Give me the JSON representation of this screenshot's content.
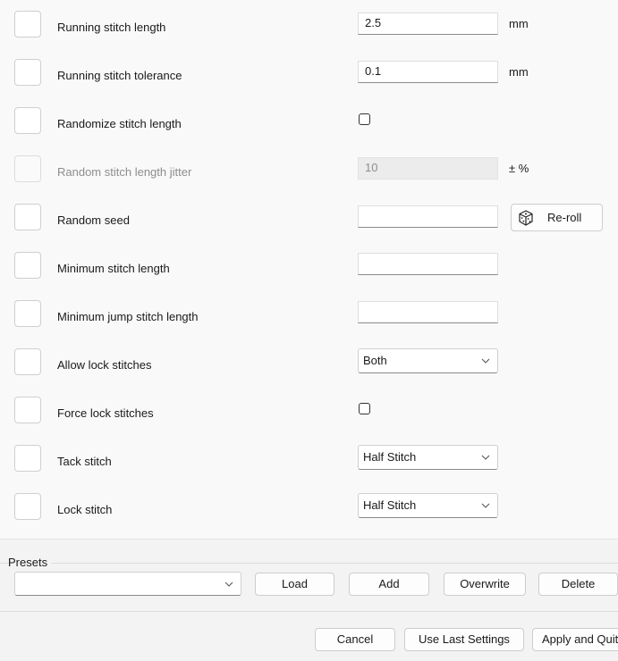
{
  "fields": [
    {
      "label": "Running stitch length",
      "value": "2.5",
      "unit": "mm"
    },
    {
      "label": "Running stitch tolerance",
      "value": "0.1",
      "unit": "mm"
    },
    {
      "label": "Randomize stitch length"
    },
    {
      "label": "Random stitch length jitter",
      "value": "10",
      "unit": "± %"
    },
    {
      "label": "Random seed",
      "value": "",
      "button": "Re-roll",
      "button_icon": "dice-icon"
    },
    {
      "label": "Minimum stitch length",
      "value": ""
    },
    {
      "label": "Minimum jump stitch length",
      "value": ""
    },
    {
      "label": "Allow lock stitches",
      "selected": "Both"
    },
    {
      "label": "Force lock stitches"
    },
    {
      "label": "Tack stitch",
      "selected": "Half Stitch"
    },
    {
      "label": "Lock stitch",
      "selected": "Half Stitch"
    }
  ],
  "presets": {
    "label": "Presets",
    "selected": "",
    "load": "Load",
    "add": "Add",
    "overwrite": "Overwrite",
    "delete": "Delete"
  },
  "footer": {
    "cancel": "Cancel",
    "use_last": "Use Last Settings",
    "apply": "Apply and Quit"
  },
  "colors": {
    "background": "#f9f9f9",
    "panel": "#f3f3f3",
    "disabled_text": "#8d8d8d"
  }
}
